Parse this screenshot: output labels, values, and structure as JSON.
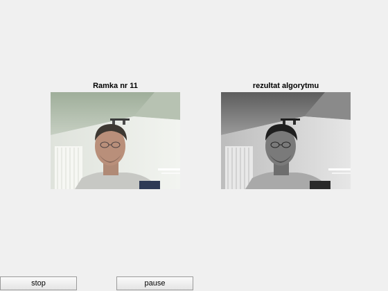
{
  "panels": {
    "left": {
      "title": "Ramka nr 11"
    },
    "right": {
      "title": "rezultat algorytmu"
    }
  },
  "controls": {
    "stop_label": "stop",
    "pause_label": "pause"
  },
  "colors": {
    "background": "#f0f0f0",
    "wall_color": "#e8ece6",
    "ceiling_green": "#a8b6a2"
  }
}
